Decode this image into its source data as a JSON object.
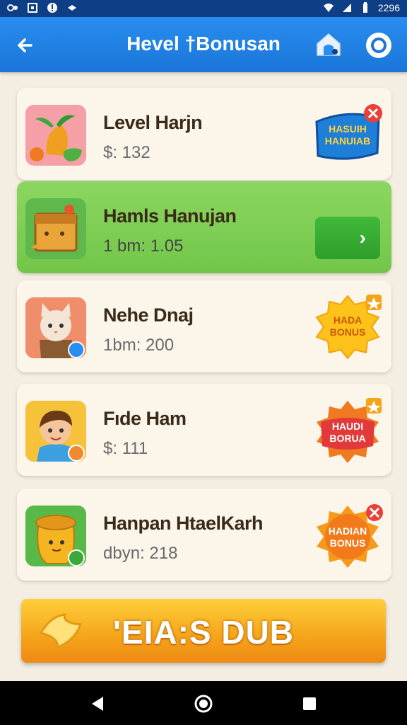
{
  "status_bar": {
    "time": "2296"
  },
  "app_bar": {
    "title": "Hevel †Bonusan"
  },
  "items": [
    {
      "name": "Level Harjn",
      "sub": "$: 132",
      "badge": "HASUIH\nHANUIAB"
    },
    {
      "name": "Hamls Hanujan",
      "sub": "1 bm: 1.05"
    },
    {
      "name": "Nehe Dnaj",
      "sub": "1bm: 200",
      "badge": "HADA\nBONUS"
    },
    {
      "name": "Fıde Ham",
      "sub": "$: 111",
      "badge": "HAUDI\nBORUA"
    },
    {
      "name": "Hanpan HtaelKarh",
      "sub": "dbyn: 218",
      "badge": "HADIAN\nBONUS"
    }
  ],
  "bottom_button": {
    "label": "'EIA:S DUB"
  },
  "colors": {
    "app_bar": "#1976d8",
    "status_bar": "#0e3f86",
    "active_card": "#7ecb55",
    "cta": "#f5a41a"
  }
}
